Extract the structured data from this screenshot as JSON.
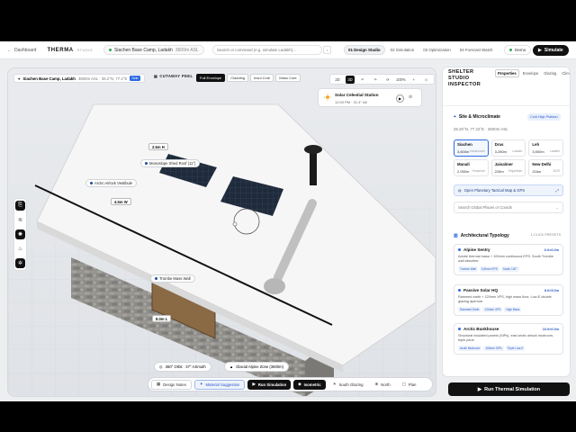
{
  "topbar": {
    "back_label": "Dashboard",
    "logo": "THERMA",
    "logo_sub": "STUDIO",
    "site_name": "Siachen Base Camp, Ladakh",
    "site_alt": "3600m ASL",
    "search_placeholder": "Search or command (e.g. simulate Ladakh)...",
    "kbd": "/",
    "tabs": [
      {
        "label": "01 Design Studio"
      },
      {
        "label": "02 Simulation"
      },
      {
        "label": "03 Optimization"
      },
      {
        "label": "04 Forecast Watch"
      }
    ],
    "demo_label": "Demo",
    "simulate_label": "Simulate"
  },
  "viewport": {
    "site_name": "Siachen Base Camp, Ladakh",
    "site_meta": "3600m ASL · 35.2°N, 77.2°E",
    "site_tag": "Sele",
    "cutaway_label": "CUTAWAY PEEL",
    "modes": [
      "Full Envelope",
      "Cladding",
      "Insul Core",
      "Mass Core"
    ],
    "view2d": "2D",
    "view3d": "3D",
    "zoom": "100%",
    "solar_title": "Solar Celestial Station",
    "solar_time": "12:00 PM · 31.4° Alt",
    "annotations": {
      "height": "2.6m H",
      "roof": "Monoslope Shed Roof (11°)",
      "airlock": "Arctic Airlock Vestibule",
      "width": "4.5m W",
      "trombe": "Trombe Mass Wall",
      "length": "8.0m L"
    },
    "orbit_label": "360° Orbit · 37° Azimuth",
    "zone_label": "Glacial Alpine Zone (3600m)",
    "bottom": {
      "design_notes": "Design Notes",
      "material": "Material Suggestion",
      "run_sim": "Run Simulation",
      "isometric": "Isometric",
      "south": "South Glazing",
      "north": "North",
      "plan": "Plan"
    }
  },
  "inspector": {
    "title_lines": [
      "SHELTER",
      "STUDIO",
      "INSPECTOR"
    ],
    "tabs": [
      "Properties",
      "Envelope",
      "Glazing",
      "Climate"
    ],
    "site_section": "Site & Microclimate",
    "site_badge": "Cold High Plateau",
    "coords": "35.20°N, 77.22°E · 3600m ASL",
    "cities": [
      {
        "name": "Siachen",
        "elev": "3,600m",
        "region": "Karakoram"
      },
      {
        "name": "Dras",
        "elev": "3,280m",
        "region": "Ladakh"
      },
      {
        "name": "Leh",
        "elev": "3,500m",
        "region": "Ladakh"
      },
      {
        "name": "Manali",
        "elev": "2,050m",
        "region": "Himachal"
      },
      {
        "name": "Jaisalmer",
        "elev": "225m",
        "region": "Rajasthan"
      },
      {
        "name": "New Delhi",
        "elev": "216m",
        "region": "NCR"
      }
    ],
    "map_button": "Open Planetary Tactical Map & GPS",
    "global_search_placeholder": "Search Global Places or Coords",
    "arch_section": "Architectural Typology",
    "arch_sub": "1-CLICK PRESETS",
    "presets": [
      {
        "name": "Alpine Sentry",
        "value": "6.0×6.0m",
        "desc": "Adobe thermal mass + 100mm continuous EPS. South Trombe wall absorber.",
        "chips": [
          "Trombe Wall",
          "100mm EPS",
          "South 130°"
        ]
      },
      {
        "name": "Passive Solar HQ",
        "value": "8.0×5.0m",
        "desc": "Rammed earth + 120mm XPS, high mass floor, Low-E double glazing aperture.",
        "chips": [
          "Rammed Earth",
          "120mm XPS",
          "High Mass"
        ]
      },
      {
        "name": "Arctic Bunkhouse",
        "value": "10.0×6.0m",
        "desc": "Structural insulated panels (SIPs), east arctic airlock mudroom, triple pane.",
        "chips": [
          "Arctic Mudroom",
          "160mm SIPs",
          "Triple Low-E"
        ]
      }
    ],
    "run_button": "Run Thermal Simulation"
  }
}
